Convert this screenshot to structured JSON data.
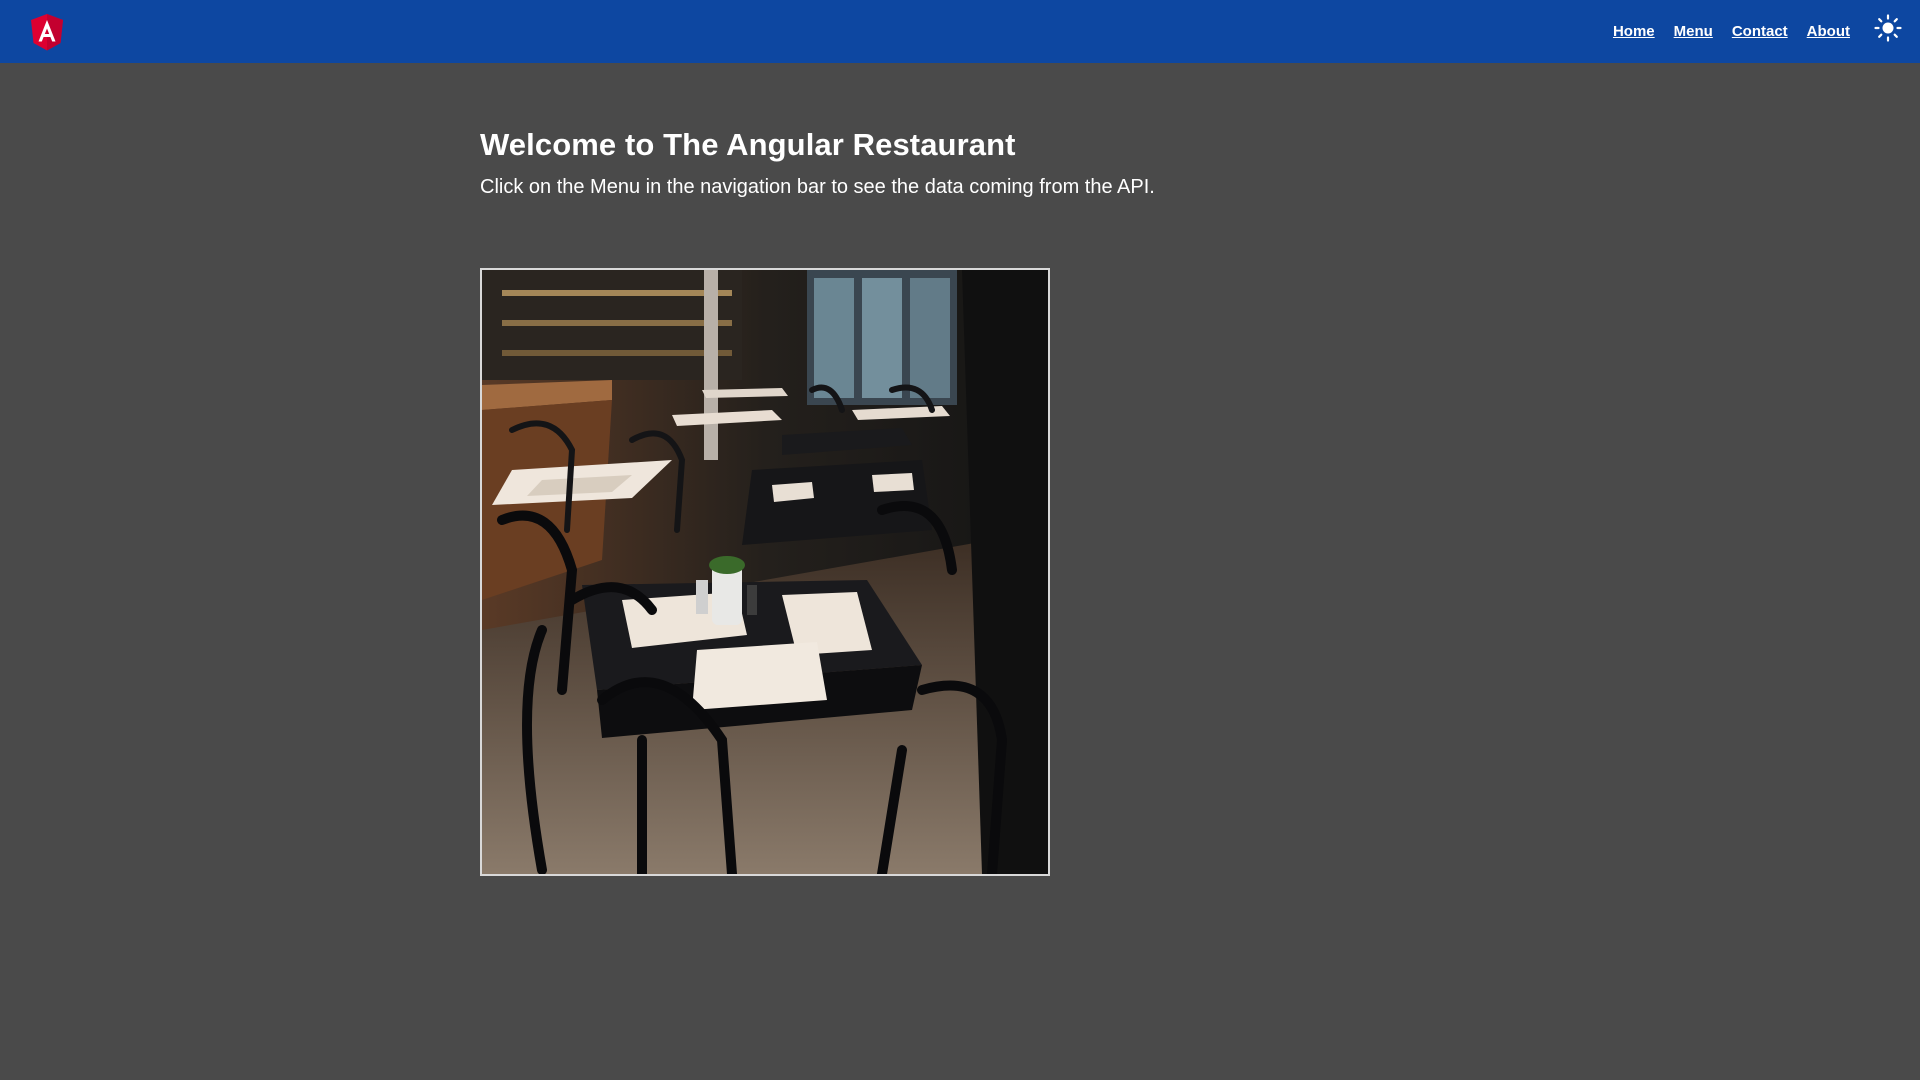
{
  "header": {
    "logo_icon": "angular-logo-icon",
    "nav": [
      {
        "label": "Home"
      },
      {
        "label": "Menu"
      },
      {
        "label": "Contact"
      },
      {
        "label": "About"
      }
    ],
    "theme_toggle_icon": "sun-icon",
    "colors": {
      "bar": "#0d47a1",
      "logo": "#dd0031"
    }
  },
  "main": {
    "title": "Welcome to The Angular Restaurant",
    "subtitle": "Click on the Menu in the navigation bar to see the data coming from the API.",
    "image_icon": "restaurant-interior-photo"
  },
  "colors": {
    "page_background": "#4a4a4a"
  }
}
